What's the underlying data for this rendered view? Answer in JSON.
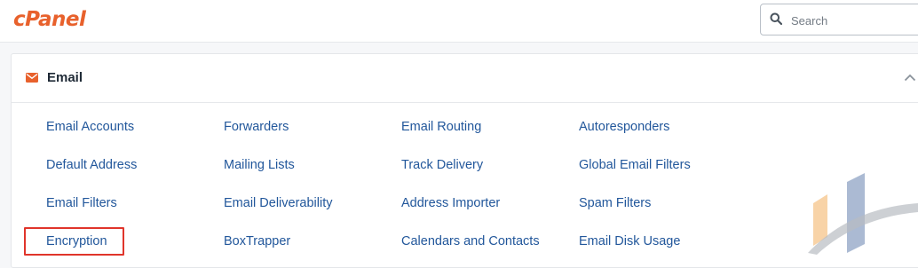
{
  "app": {
    "logo_text": "cPanel"
  },
  "search": {
    "placeholder": "Search"
  },
  "section": {
    "title": "Email",
    "links": [
      [
        "Email Accounts",
        "Forwarders",
        "Email Routing",
        "Autoresponders"
      ],
      [
        "Default Address",
        "Mailing Lists",
        "Track Delivery",
        "Global Email Filters"
      ],
      [
        "Email Filters",
        "Email Deliverability",
        "Address Importer",
        "Spam Filters"
      ],
      [
        "Encryption",
        "BoxTrapper",
        "Calendars and Contacts",
        "Email Disk Usage"
      ]
    ],
    "highlighted": "Encryption"
  },
  "icons": {
    "search": "search-icon",
    "section": "envelope-icon",
    "collapse": "chevron-up-icon"
  },
  "colors": {
    "brand": "#e8612c",
    "link": "#22579b",
    "highlight_border": "#e0352b"
  }
}
